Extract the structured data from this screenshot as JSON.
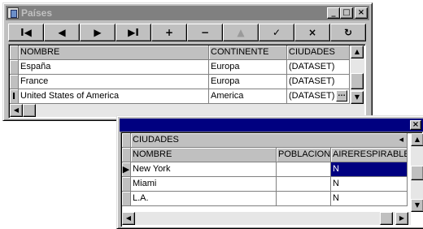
{
  "paises_window": {
    "title": "Países",
    "caption_buttons": [
      "_",
      "□",
      "×"
    ],
    "navigator": [
      "I◀",
      "◀",
      "▶",
      "▶I",
      "+",
      "−",
      "▲",
      "✓",
      "×",
      "↻"
    ],
    "grid": {
      "columns": [
        "NOMBRE",
        "CONTINENTE",
        "CIUDADES"
      ],
      "rows": [
        {
          "nombre": "España",
          "continente": "Europa",
          "ciudades": "(DATASET)"
        },
        {
          "nombre": "France",
          "continente": "Europa",
          "ciudades": "(DATASET)"
        },
        {
          "nombre": "United States of America",
          "continente": "America",
          "ciudades": "(DATASET)"
        }
      ],
      "current_row_indicator": "I",
      "ellipsis": "…"
    }
  },
  "ciudades_window": {
    "close_button": "×",
    "band_title": "CIUDADES",
    "band_arrow": "◂",
    "columns": [
      "NOMBRE",
      "POBLACION",
      "AIRERESPIRABLE"
    ],
    "rows": [
      {
        "nombre": "New York",
        "poblacion": "",
        "aire": "N"
      },
      {
        "nombre": "Miami",
        "poblacion": "",
        "aire": "N"
      },
      {
        "nombre": "L.A.",
        "poblacion": "",
        "aire": "N"
      }
    ],
    "current_row_indicator": "▶"
  },
  "colors": {
    "face": "#c0c0c0",
    "inactive_title": "#808080",
    "active_title": "#000080",
    "selection": "#000080"
  }
}
